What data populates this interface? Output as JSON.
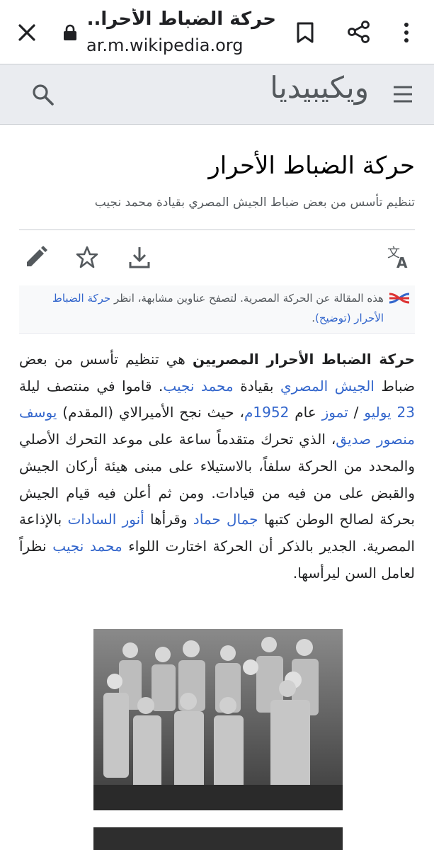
{
  "browser": {
    "tab_title": "حركة الضباط الأحرا...",
    "url": "ar.m.wikipedia.org"
  },
  "header": {
    "logo": "ويكيبيديا"
  },
  "page": {
    "title": "حركة الضباط الأحرار",
    "subtitle": "تنظيم تأسس من بعض ضباط الجيش المصري بقيادة محمد نجيب"
  },
  "hatnote": {
    "text_before": "هذه المقالة عن الحركة المصرية. لتصفح عناوين مشابهة، انظر ",
    "link": "حركة الضباط الأحرار (توضيح)",
    "text_after": "."
  },
  "article": {
    "t1": "حركة الضباط الأحرار المصريين",
    "t2": " هي تنظيم تأسس من بعض ضباط ",
    "l1": "الجيش المصري",
    "t3": " بقيادة ",
    "l2": "محمد نجيب",
    "t4": ". قاموا في منتصف ليلة ",
    "l3": "23 يوليو",
    "t5": " / ",
    "l4": "تموز",
    "t6": " عام ",
    "l5": "1952م",
    "t7": "، حيث نجح الأميرالاي (المقدم) ",
    "l6": "يوسف منصور صديق",
    "t8": "، الذي تحرك متقدماً ساعة على موعد التحرك الأصلي والمحدد من الحركة سلفاً، بالاستيلاء على مبنى هيئة أركان الجيش والقبض على من فيه من قيادات. ومن ثم أعلن فيه قيام الجيش بحركة لصالح الوطن كتبها ",
    "l7": "جمال حماد",
    "t9": " وقرأها ",
    "l8": "أنور السادات",
    "t10": " بالإذاعة المصرية. الجدير بالذكر أن الحركة اختارت اللواء ",
    "l9": "محمد نجيب",
    "t11": " نظراً لعامل السن ليرأسها."
  },
  "colors": {
    "link": "#3366cc",
    "header_bg": "#eaecf0",
    "hatnote_bg": "#f8f9fa"
  },
  "icons": [
    "close-icon",
    "lock-icon",
    "bookmark-icon",
    "share-icon",
    "more-vert-icon",
    "menu-icon",
    "search-icon",
    "edit-icon",
    "star-icon",
    "download-icon",
    "translate-icon",
    "disambiguation-icon"
  ]
}
